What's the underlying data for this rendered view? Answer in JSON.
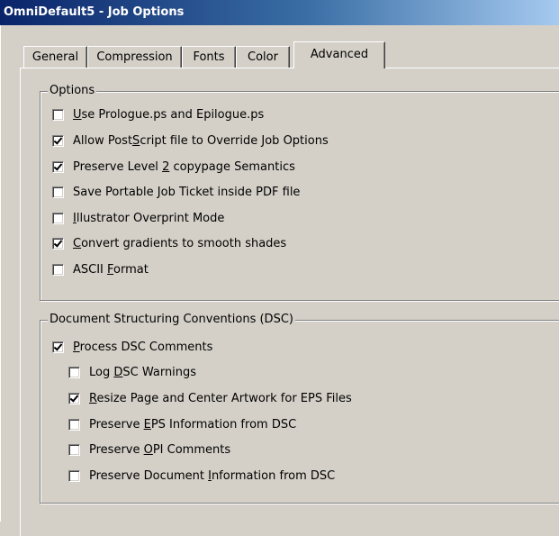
{
  "window": {
    "title": "OmniDefault5 - Job Options"
  },
  "tabs": [
    {
      "label": "General",
      "selected": false
    },
    {
      "label": "Compression",
      "selected": false
    },
    {
      "label": "Fonts",
      "selected": false
    },
    {
      "label": "Color",
      "selected": false
    },
    {
      "label": "Advanced",
      "selected": true
    }
  ],
  "options_group": {
    "title": "Options",
    "items": [
      {
        "pre": "",
        "key": "U",
        "post": "se Prologue.ps and Epilogue.ps",
        "checked": false
      },
      {
        "pre": "Allow PostScript file to Override Job Options",
        "key": "",
        "post": "",
        "checked": true
      },
      {
        "pre": "Preserve Level ",
        "key": "2",
        "post": " copypage Semantics",
        "checked": true
      },
      {
        "pre": "Save Portable ",
        "key": "J",
        "post": "ob Ticket inside PDF file",
        "checked": false
      },
      {
        "pre": "",
        "key": "I",
        "post": "llustrator Overprint Mode",
        "checked": false
      },
      {
        "pre": "",
        "key": "C",
        "post": "onvert gradients to smooth shades",
        "checked": true
      },
      {
        "pre": "ASCII ",
        "key": "F",
        "post": "ormat",
        "checked": false
      }
    ]
  },
  "dsc_group": {
    "title": "Document Structuring Conventions (DSC)",
    "items": [
      {
        "pre": "",
        "key": "P",
        "post": "rocess DSC Comments",
        "checked": true
      },
      {
        "pre": "Log ",
        "key": "D",
        "post": "SC Warnings",
        "checked": false
      },
      {
        "pre": "",
        "key": "R",
        "post": "esize Page and Center Artwork for EPS Files",
        "checked": true
      },
      {
        "pre": "Preserve ",
        "key": "E",
        "post": "PS Information from DSC",
        "checked": false
      },
      {
        "pre": "Preserve ",
        "key": "O",
        "post": "PI Comments",
        "checked": false
      },
      {
        "pre": "Preserve Document ",
        "key": "I",
        "post": "nformation from DSC",
        "checked": false
      }
    ]
  }
}
